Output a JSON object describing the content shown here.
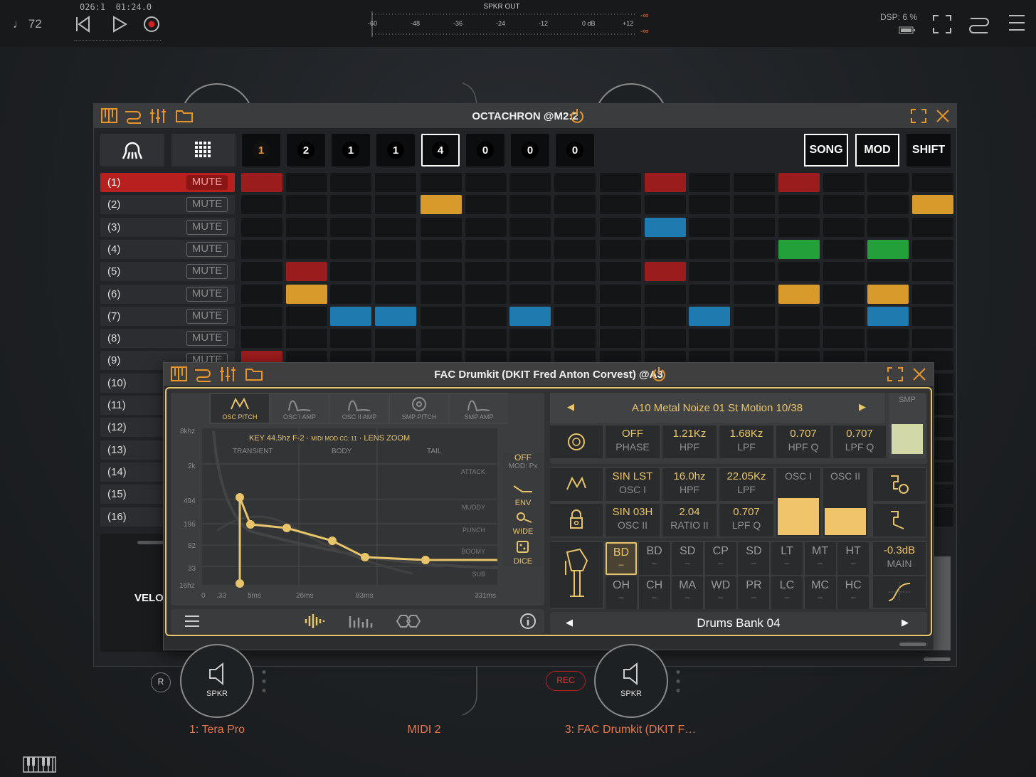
{
  "transport": {
    "tempo": "72",
    "position": "026:1",
    "time": "01:24.0"
  },
  "meter": {
    "title": "SPKR OUT",
    "ticks": [
      "-60",
      "-48",
      "-36",
      "-24",
      "-12",
      "0 dB",
      "+12"
    ],
    "peak_top": "-∞",
    "peak_bottom": "-∞"
  },
  "dsp": {
    "label": "DSP:",
    "value": "6 %"
  },
  "nodes": [
    {
      "label": "SPKR",
      "name": "1: Tera Pro"
    },
    {
      "label": "SPKR",
      "name": "3: FAC Drumkit (DKIT F…"
    }
  ],
  "midi_label": "MIDI 2",
  "r_label": "R",
  "rec_label": "REC",
  "velo_label": "VELO",
  "octachron": {
    "title": "OCTACHRON @M2:2",
    "patterns": [
      "1",
      "2",
      "1",
      "1",
      "4",
      "0",
      "0",
      "0"
    ],
    "right_buttons": [
      "SONG",
      "MOD",
      "SHIFT"
    ],
    "mute_label": "MUTE",
    "tracks": [
      "(1)",
      "(2)",
      "(3)",
      "(4)",
      "(5)",
      "(6)",
      "(7)",
      "(8)",
      "(9)",
      "(10)",
      "(11)",
      "(12)",
      "(13)",
      "(14)",
      "(15)",
      "(16)"
    ],
    "colors": {
      "red": "#9b1c1c",
      "orange": "#d89a2a",
      "blue": "#1f7ab0",
      "green": "#24a03a"
    },
    "steps": [
      {
        "row": 0,
        "col": 0,
        "color": "red"
      },
      {
        "row": 0,
        "col": 9,
        "color": "red"
      },
      {
        "row": 0,
        "col": 12,
        "color": "red"
      },
      {
        "row": 1,
        "col": 4,
        "color": "orange"
      },
      {
        "row": 1,
        "col": 15,
        "color": "orange"
      },
      {
        "row": 2,
        "col": 9,
        "color": "blue"
      },
      {
        "row": 3,
        "col": 12,
        "color": "green"
      },
      {
        "row": 3,
        "col": 14,
        "color": "green"
      },
      {
        "row": 4,
        "col": 1,
        "color": "red"
      },
      {
        "row": 4,
        "col": 9,
        "color": "red"
      },
      {
        "row": 5,
        "col": 1,
        "color": "orange"
      },
      {
        "row": 5,
        "col": 12,
        "color": "orange"
      },
      {
        "row": 5,
        "col": 14,
        "color": "orange"
      },
      {
        "row": 6,
        "col": 2,
        "color": "blue"
      },
      {
        "row": 6,
        "col": 3,
        "color": "blue"
      },
      {
        "row": 6,
        "col": 6,
        "color": "blue"
      },
      {
        "row": 6,
        "col": 10,
        "color": "blue"
      },
      {
        "row": 6,
        "col": 14,
        "color": "blue"
      },
      {
        "row": 8,
        "col": 0,
        "color": "red"
      }
    ]
  },
  "drumkit": {
    "title": "FAC Drumkit (DKIT Fred Anton Corvest) @A3",
    "tabs": [
      "OSC PITCH",
      "OSC I AMP",
      "OSC II AMP",
      "SMP PITCH",
      "SMP AMP"
    ],
    "graph": {
      "info_key": "KEY 44.5hz F-2",
      "info_midi": "MIDI MOD CC: 11",
      "info_lens": "LENS ZOOM",
      "sections": [
        "TRANSIENT",
        "BODY",
        "TAIL"
      ],
      "y_labels": [
        "8khz",
        "2k",
        "494",
        "196",
        "82",
        "33",
        "16hz"
      ],
      "x_labels": [
        "0",
        ".33",
        "5ms",
        "26ms",
        "83ms",
        "331ms"
      ],
      "right_labels": [
        "ATTACK",
        "MUDDY",
        "PUNCH",
        "BOOMY",
        "SUB"
      ],
      "side_buttons": [
        {
          "top": "OFF",
          "sub": "MOD: Px"
        },
        {
          "top": "ENV"
        },
        {
          "top": "WIDE"
        },
        {
          "top": "DICE"
        }
      ]
    },
    "sample": {
      "name": "A10 Metal Noize 01 St Motion 10/38",
      "smp": "SMP"
    },
    "row1": [
      {
        "v": "OFF",
        "n": "PHASE"
      },
      {
        "v": "1.21Kz",
        "n": "HPF"
      },
      {
        "v": "1.68Kz",
        "n": "LPF"
      },
      {
        "v": "0.707",
        "n": "HPF Q"
      },
      {
        "v": "0.707",
        "n": "LPF Q"
      }
    ],
    "row2": [
      {
        "v": "SIN LST",
        "n": "OSC I"
      },
      {
        "v": "16.0hz",
        "n": "HPF"
      },
      {
        "v": "22.05Kz",
        "n": "LPF"
      }
    ],
    "row3": [
      {
        "v": "SIN 03H",
        "n": "OSC II"
      },
      {
        "v": "2.04",
        "n": "RATIO II"
      },
      {
        "v": "0.707",
        "n": "LPF Q"
      }
    ],
    "osc_labels": [
      "OSC I",
      "OSC II"
    ],
    "pads_row1": [
      "BD",
      "BD",
      "SD",
      "CP",
      "SD",
      "LT",
      "MT",
      "HT"
    ],
    "pads_row2": [
      "OH",
      "CH",
      "MA",
      "WD",
      "PR",
      "LC",
      "MC",
      "HC"
    ],
    "pad_dash": "–",
    "main": {
      "v": "-0.3dB",
      "n": "MAIN"
    },
    "bank": "Drums Bank 04"
  }
}
